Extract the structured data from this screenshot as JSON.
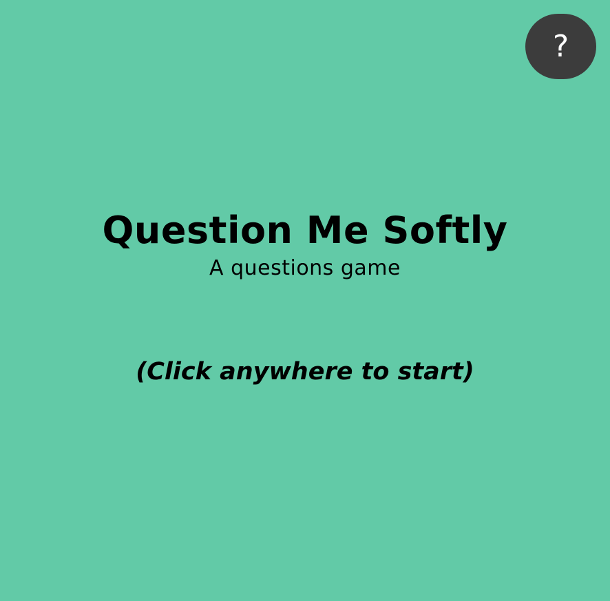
{
  "colors": {
    "background": "#62caa7",
    "help_button_bg": "#3c3c3c",
    "help_button_fg": "#ffffff",
    "text": "#000000"
  },
  "help_button": {
    "label": "?",
    "icon": "question-mark-icon"
  },
  "title": "Question Me Softly",
  "subtitle": "A questions game",
  "start_prompt": "(Click anywhere to start)"
}
